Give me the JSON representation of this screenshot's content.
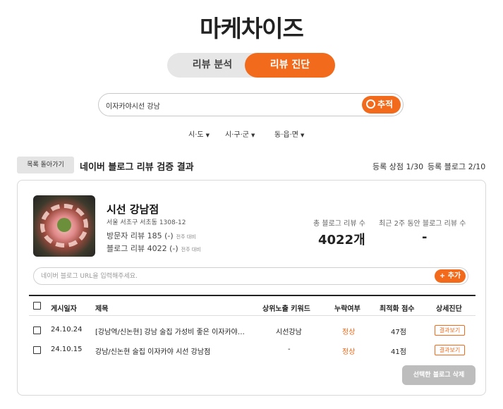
{
  "brand": {
    "logo_text": "마케차이즈"
  },
  "mode_tabs": {
    "analysis": "리뷰 분석",
    "diagnosis": "리뷰 진단",
    "active": "diagnosis"
  },
  "search": {
    "value": "이자카야시선 강남",
    "button_label": "추적"
  },
  "region_filters": {
    "sido": "시·도",
    "sigungu": "시·구·군",
    "dong": "동·읍·면"
  },
  "result_header": {
    "back_label": "목록 돌아가기",
    "title": "네이버 블로그 리뷰 검증 결과",
    "store_count": "등록 상점 1/30",
    "blog_count": "등록 블로그 2/10"
  },
  "store": {
    "name": "시선 강남점",
    "address": "서울 서초구 서초동 1308-12",
    "visitor_review": "방문자 리뷰 185 (-)",
    "visitor_compare": "전주 대비",
    "blog_review": "블로그 리뷰 4022 (-)",
    "blog_compare": "전주 대비",
    "total_label": "총 블로그 리뷰 수",
    "total_value": "4022개",
    "recent_label": "최근 2주 동안 블로그 리뷰 수",
    "recent_value": "-"
  },
  "url_input": {
    "placeholder": "네이버 블로그 URL을 입력해주세요.",
    "add_label": "+ 추가"
  },
  "table": {
    "headers": {
      "date": "게시일자",
      "title": "제목",
      "keyword": "상위노출 키워드",
      "missing": "누락여부",
      "score": "최적화 점수",
      "detail": "상세진단"
    },
    "rows": [
      {
        "date": "24.10.24",
        "title": "[강남역/신논현] 강남 술집 가성비 좋은 이자카야 시선 강남점",
        "keyword": "시선강남",
        "missing": "정상",
        "score": "47점",
        "detail": "결과보기"
      },
      {
        "date": "24.10.15",
        "title": "강남/신논현 술집 이자카야 시선 강남점",
        "keyword": "-",
        "missing": "정상",
        "score": "41점",
        "detail": "결과보기"
      }
    ]
  },
  "delete_button": "선택한 블로그 삭제",
  "colors": {
    "accent": "#f26a1b",
    "disabled": "#bdbdbd"
  }
}
